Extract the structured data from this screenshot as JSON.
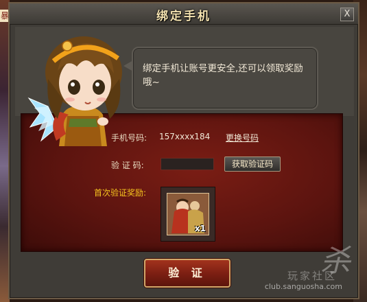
{
  "background": {
    "left_tag": "暴"
  },
  "dialog": {
    "title": "绑定手机",
    "close_label": "X"
  },
  "bubble": {
    "text": "绑定手机让账号更安全,还可以领取奖励哦~"
  },
  "form": {
    "phone_label": "手机号码:",
    "phone_value": "157xxxx184",
    "change_number_link": "更换号码",
    "code_label": "验 证 码:",
    "code_value": "",
    "get_code_button": "获取验证码",
    "reward_label": "首次验证奖励:",
    "reward_count": "x1"
  },
  "verify_button": "验 证",
  "watermark": {
    "logo": "杀",
    "cn": "玩家社区",
    "url": "club.sanguosha.com"
  },
  "colors": {
    "title": "#f4e2b0",
    "reward_label": "#f6c51f",
    "panel_red": "#5c140f"
  }
}
